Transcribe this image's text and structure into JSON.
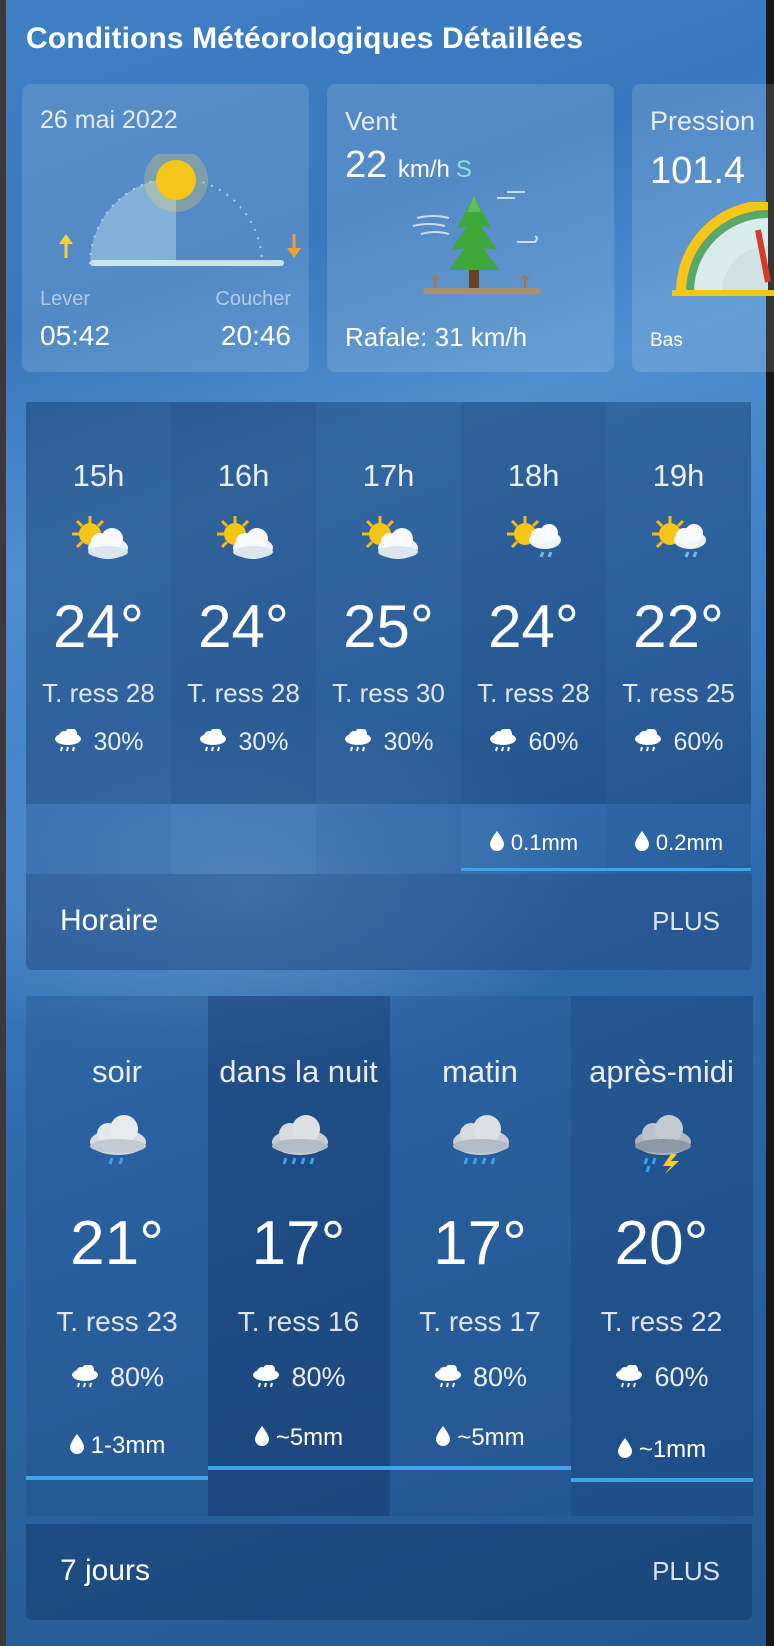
{
  "page": {
    "title": "Conditions Météorologiques Détaillées"
  },
  "sun": {
    "date": "26 mai 2022",
    "sunrise_label": "Lever",
    "sunset_label": "Coucher",
    "sunrise": "05:42",
    "sunset": "20:46"
  },
  "wind": {
    "title": "Vent",
    "speed": "22",
    "unit": "km/h",
    "direction": "S",
    "gust": "Rafale: 31 km/h",
    "icon": "windy-tree-icon"
  },
  "pressure": {
    "title": "Pression",
    "value": "101.4",
    "low_label": "Bas",
    "icon": "pressure-gauge-icon"
  },
  "hourly": {
    "items": [
      {
        "time": "15h",
        "icon": "partly-cloudy-icon",
        "temp": "24°",
        "feels": "T. ress 28",
        "pop": "30%",
        "precip": ""
      },
      {
        "time": "16h",
        "icon": "partly-cloudy-icon",
        "temp": "24°",
        "feels": "T. ress 28",
        "pop": "30%",
        "precip": ""
      },
      {
        "time": "17h",
        "icon": "partly-cloudy-icon",
        "temp": "25°",
        "feels": "T. ress 30",
        "pop": "30%",
        "precip": ""
      },
      {
        "time": "18h",
        "icon": "sun-showers-icon",
        "temp": "24°",
        "feels": "T. ress 28",
        "pop": "60%",
        "precip": "0.1mm"
      },
      {
        "time": "19h",
        "icon": "sun-showers-icon",
        "temp": "22°",
        "feels": "T. ress 25",
        "pop": "60%",
        "precip": "0.2mm"
      }
    ],
    "footer_title": "Horaire",
    "more_label": "PLUS"
  },
  "daily": {
    "items": [
      {
        "name": "soir",
        "icon": "rain-cloud-icon",
        "temp": "21°",
        "feels": "T. ress 23",
        "pop": "80%",
        "precip": "1-3mm"
      },
      {
        "name": "dans la nuit",
        "icon": "heavy-rain-cloud-icon",
        "temp": "17°",
        "feels": "T. ress 16",
        "pop": "80%",
        "precip": "~5mm"
      },
      {
        "name": "matin",
        "icon": "heavy-rain-cloud-icon",
        "temp": "17°",
        "feels": "T. ress 17",
        "pop": "80%",
        "precip": "~5mm"
      },
      {
        "name": "après-midi",
        "icon": "thunderstorm-icon",
        "temp": "20°",
        "feels": "T. ress 22",
        "pop": "60%",
        "precip": "~1mm"
      }
    ],
    "footer_title": "7 jours",
    "more_label": "PLUS"
  },
  "colors": {
    "accent": "#3fa4e8",
    "sun": "#f5c518",
    "background": "#3a78bd"
  }
}
